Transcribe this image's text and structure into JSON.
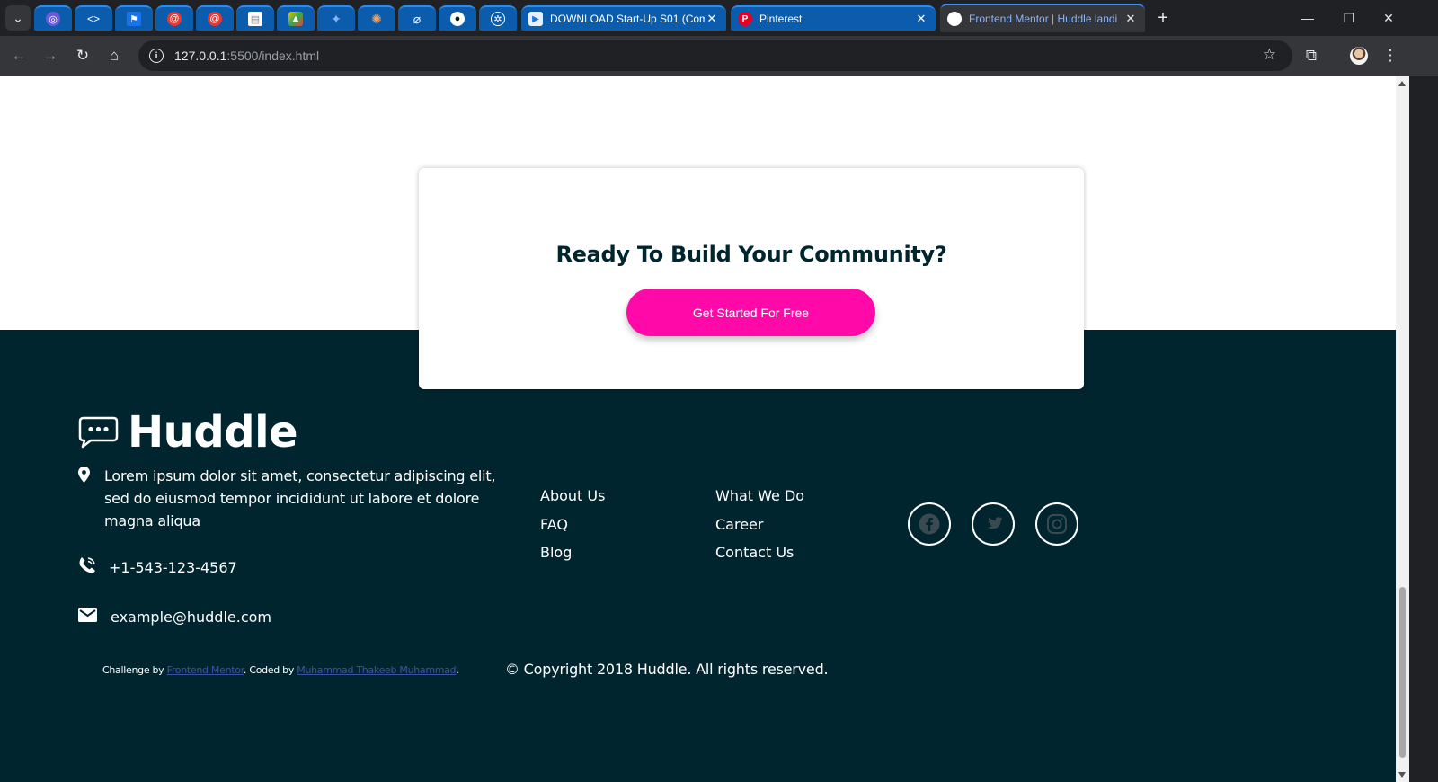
{
  "browser": {
    "pinned_tabs": [
      {
        "icon": "purple-spiral-icon"
      },
      {
        "icon": "code-brackets-icon"
      },
      {
        "icon": "blue-flag-icon"
      },
      {
        "icon": "red-swirl-icon"
      },
      {
        "icon": "red-swirl-icon"
      },
      {
        "icon": "white-document-icon"
      },
      {
        "icon": "colorful-logo-icon"
      },
      {
        "icon": "sparkle-icon"
      },
      {
        "icon": "orange-burst-icon"
      },
      {
        "icon": "slashed-circle-icon"
      },
      {
        "icon": "github-icon"
      },
      {
        "icon": "openai-icon"
      }
    ],
    "tabs": [
      {
        "title": "DOWNLOAD Start-Up S01 (Com",
        "icon": "download-site-icon"
      },
      {
        "title": "Pinterest",
        "icon": "pinterest-icon"
      },
      {
        "title": "Frontend Mentor | Huddle landi",
        "icon": "frontend-mentor-icon",
        "active": true
      }
    ],
    "url_host": "127.0.0.1",
    "url_path": ":5500/index.html"
  },
  "cta": {
    "title": "Ready To Build Your Community?",
    "button_label": "Get Started For Free"
  },
  "footer": {
    "brand": "Huddle",
    "address": "Lorem ipsum dolor sit amet, consectetur adipiscing elit, sed do eiusmod tempor incididunt ut labore et dolore magna aliqua",
    "phone": "+1-543-123-4567",
    "email": "example@huddle.com",
    "links_col1": [
      "About Us",
      "FAQ",
      "Blog"
    ],
    "links_col2": [
      "What We Do",
      "Career",
      "Contact Us"
    ],
    "social": [
      "facebook-icon",
      "twitter-icon",
      "instagram-icon"
    ],
    "credit": {
      "prefix": "Challenge by ",
      "link1": "Frontend Mentor",
      "middle": ". Coded by ",
      "link2": "Muhammad Thakeeb Muhammad",
      "suffix": "."
    },
    "copyright": "© Copyright 2018 Huddle. All rights reserved."
  },
  "colors": {
    "footer_bg": "#00252e",
    "cta_button": "#ff0aa9",
    "credit_link": "#3e52a3",
    "tab_blue": "#0b5cad"
  }
}
